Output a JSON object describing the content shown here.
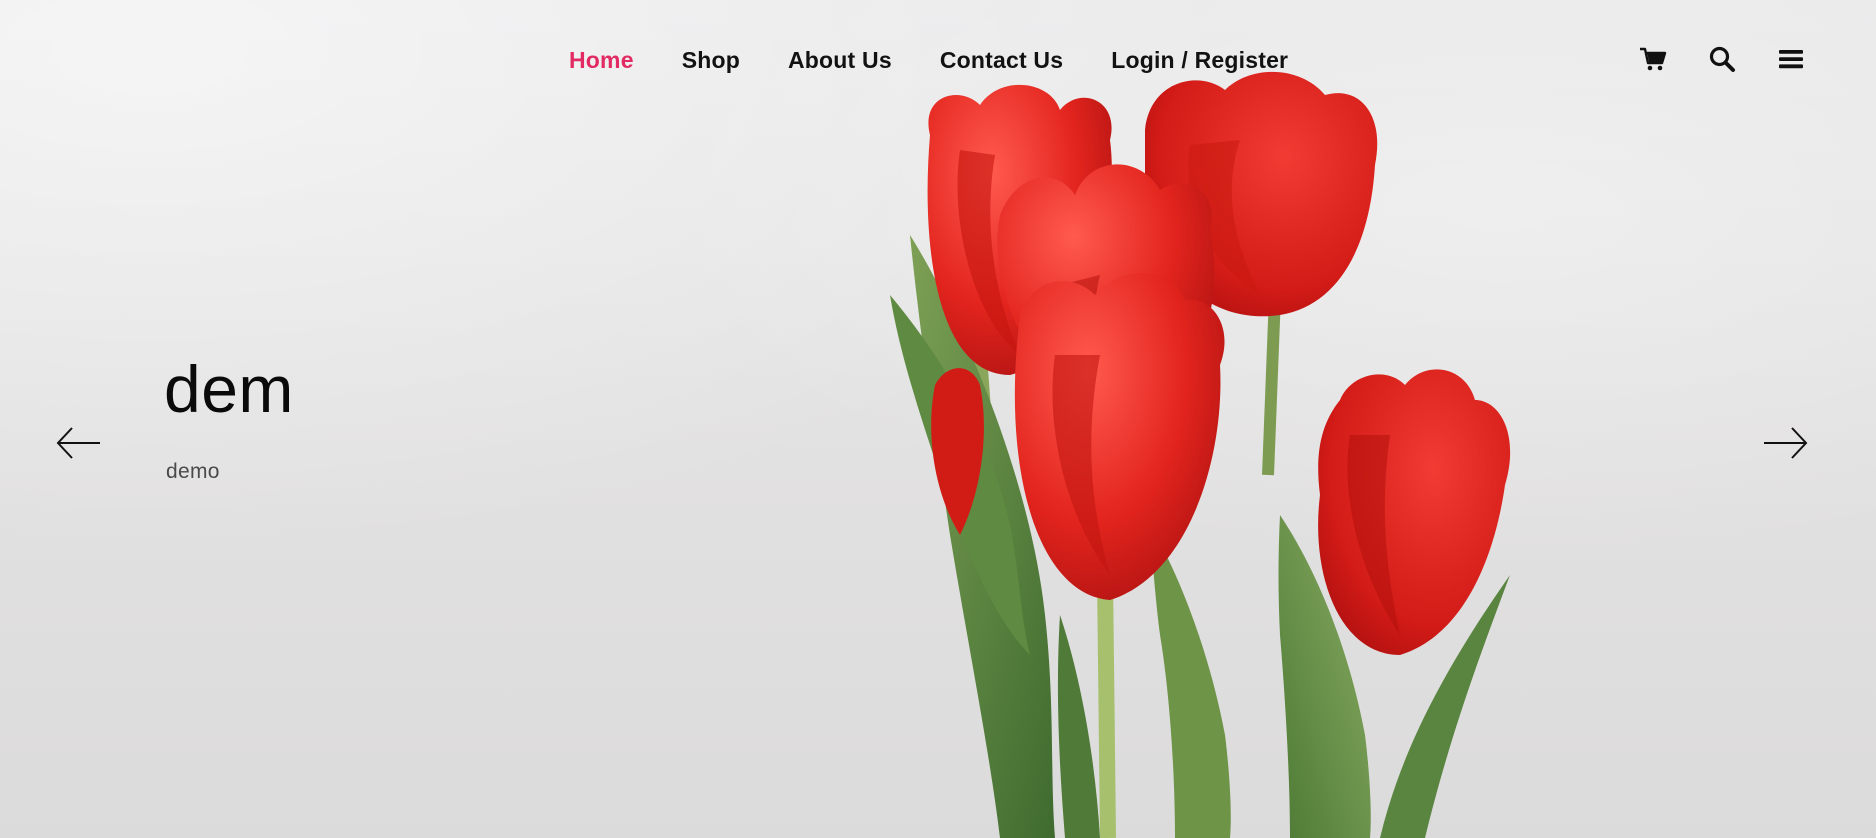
{
  "nav": {
    "items": [
      {
        "label": "Home",
        "active": true
      },
      {
        "label": "Shop",
        "active": false
      },
      {
        "label": "About Us",
        "active": false
      },
      {
        "label": "Contact Us",
        "active": false
      },
      {
        "label": "Login / Register",
        "active": false
      }
    ],
    "icons": [
      "cart-icon",
      "search-icon",
      "menu-icon"
    ]
  },
  "slide": {
    "title": "dem",
    "subtitle": "demo",
    "image": "red-tulips-bouquet"
  },
  "colors": {
    "accent": "#e22a63",
    "text": "#121212",
    "background": "#e4e3e3",
    "tulip": "#e1241d",
    "leaf": "#5f8a41"
  }
}
